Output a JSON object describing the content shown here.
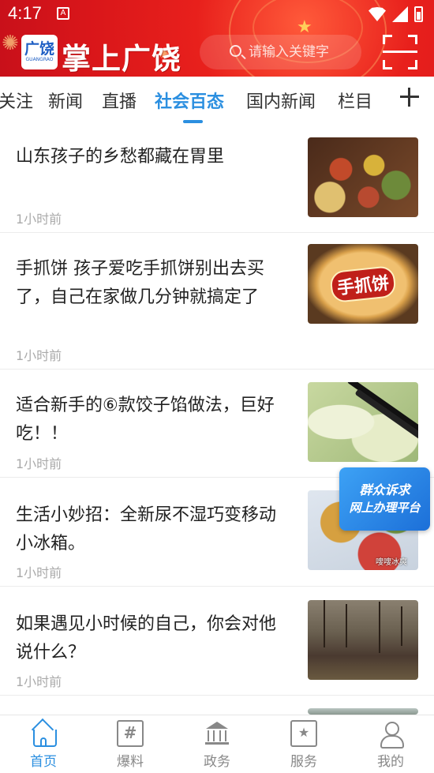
{
  "status_bar": {
    "time": "4:17",
    "notification_icon": "A"
  },
  "header": {
    "logo_glyph": "广饶",
    "logo_small": "GUANGRAO",
    "app_name": "掌上广饶",
    "search_placeholder": "请输入关键字",
    "accent_color": "#d9161a"
  },
  "tabs": [
    {
      "label": "关注"
    },
    {
      "label": "新闻"
    },
    {
      "label": "直播"
    },
    {
      "label": "社会百态",
      "active": true
    },
    {
      "label": "国内新闻"
    },
    {
      "label": "栏目"
    }
  ],
  "active_tab_color": "#2b8fe0",
  "feed": [
    {
      "title": "山东孩子的乡愁都藏在胃里",
      "time": "1小时前"
    },
    {
      "title": "手抓饼  孩子爱吃手抓饼别出去买了，自己在家做几分钟就搞定了",
      "time": "1小时前",
      "image_text": "手抓饼"
    },
    {
      "title": "适合新手的⑥款饺子馅做法，巨好吃！！",
      "time": "1小时前"
    },
    {
      "title": "生活小妙招：全新尿不湿巧变移动小冰箱。",
      "time": "1小时前",
      "image_caption": "嗖嗖冰爽"
    },
    {
      "title": "如果遇见小时候的自己，你会对他说什么？",
      "time": "1小时前"
    }
  ],
  "floating_badge": {
    "line1": "群众诉求",
    "line2": "网上办理平台"
  },
  "bottom_nav": [
    {
      "label": "首页",
      "icon": "home-icon",
      "active": true
    },
    {
      "label": "爆料",
      "icon": "report-icon",
      "glyph": "#"
    },
    {
      "label": "政务",
      "icon": "government-icon"
    },
    {
      "label": "服务",
      "icon": "service-icon",
      "glyph": "★"
    },
    {
      "label": "我的",
      "icon": "profile-icon"
    }
  ]
}
